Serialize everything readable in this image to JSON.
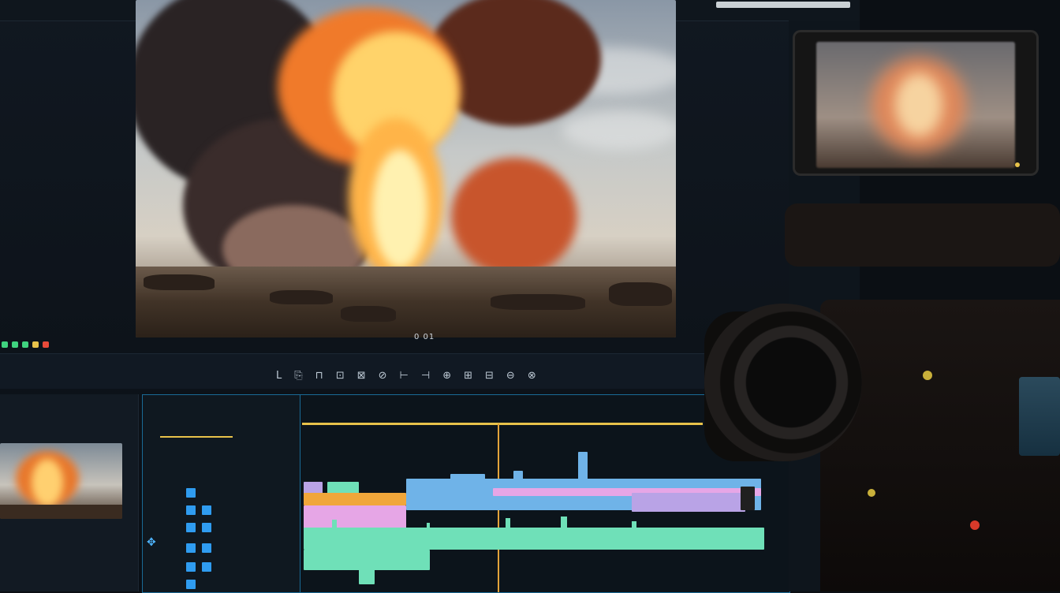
{
  "preview": {
    "timecode": "0 01"
  },
  "transport": {
    "readouts": [
      "",
      "",
      "",
      "",
      "",
      "",
      "",
      "",
      "",
      "",
      "",
      "",
      ""
    ],
    "controls": [
      "L",
      "⎘",
      "⊓",
      "⊡",
      "⊠",
      "⊘",
      "⊢",
      "⊣",
      "⊕",
      "⊞",
      "⊟",
      "⊖",
      "⊗"
    ]
  },
  "bin": {
    "title": "",
    "items": [
      {
        "name": "",
        "dur": ""
      },
      {
        "name": "",
        "dur": ""
      },
      {
        "name": "",
        "dur": ""
      },
      {
        "name": "",
        "dur": ""
      }
    ]
  },
  "tracks": {
    "title": "",
    "sub_left": "",
    "sub_right": "",
    "rows": [
      {
        "label": ""
      },
      {
        "label": ""
      },
      {
        "label": ""
      },
      {
        "label": ""
      },
      {
        "label": ""
      },
      {
        "label": ""
      }
    ]
  },
  "timeline": {
    "ruler": [
      "",
      "",
      "",
      "",
      "",
      "",
      "",
      ""
    ],
    "clips": [
      {
        "color": "#f0a63a",
        "label": ""
      },
      {
        "color": "#e6a6e6",
        "label": ""
      },
      {
        "color": "#6fb3e8",
        "label": ""
      },
      {
        "color": "#86c5ef",
        "label": ""
      },
      {
        "color": "#b9a3e6",
        "label": ""
      },
      {
        "color": "#6fe0b8",
        "label": ""
      }
    ]
  },
  "colors": {
    "accent_blue": "#2f9cf0",
    "playhead": "#e3a33a",
    "work_area": "#e8c24a"
  }
}
